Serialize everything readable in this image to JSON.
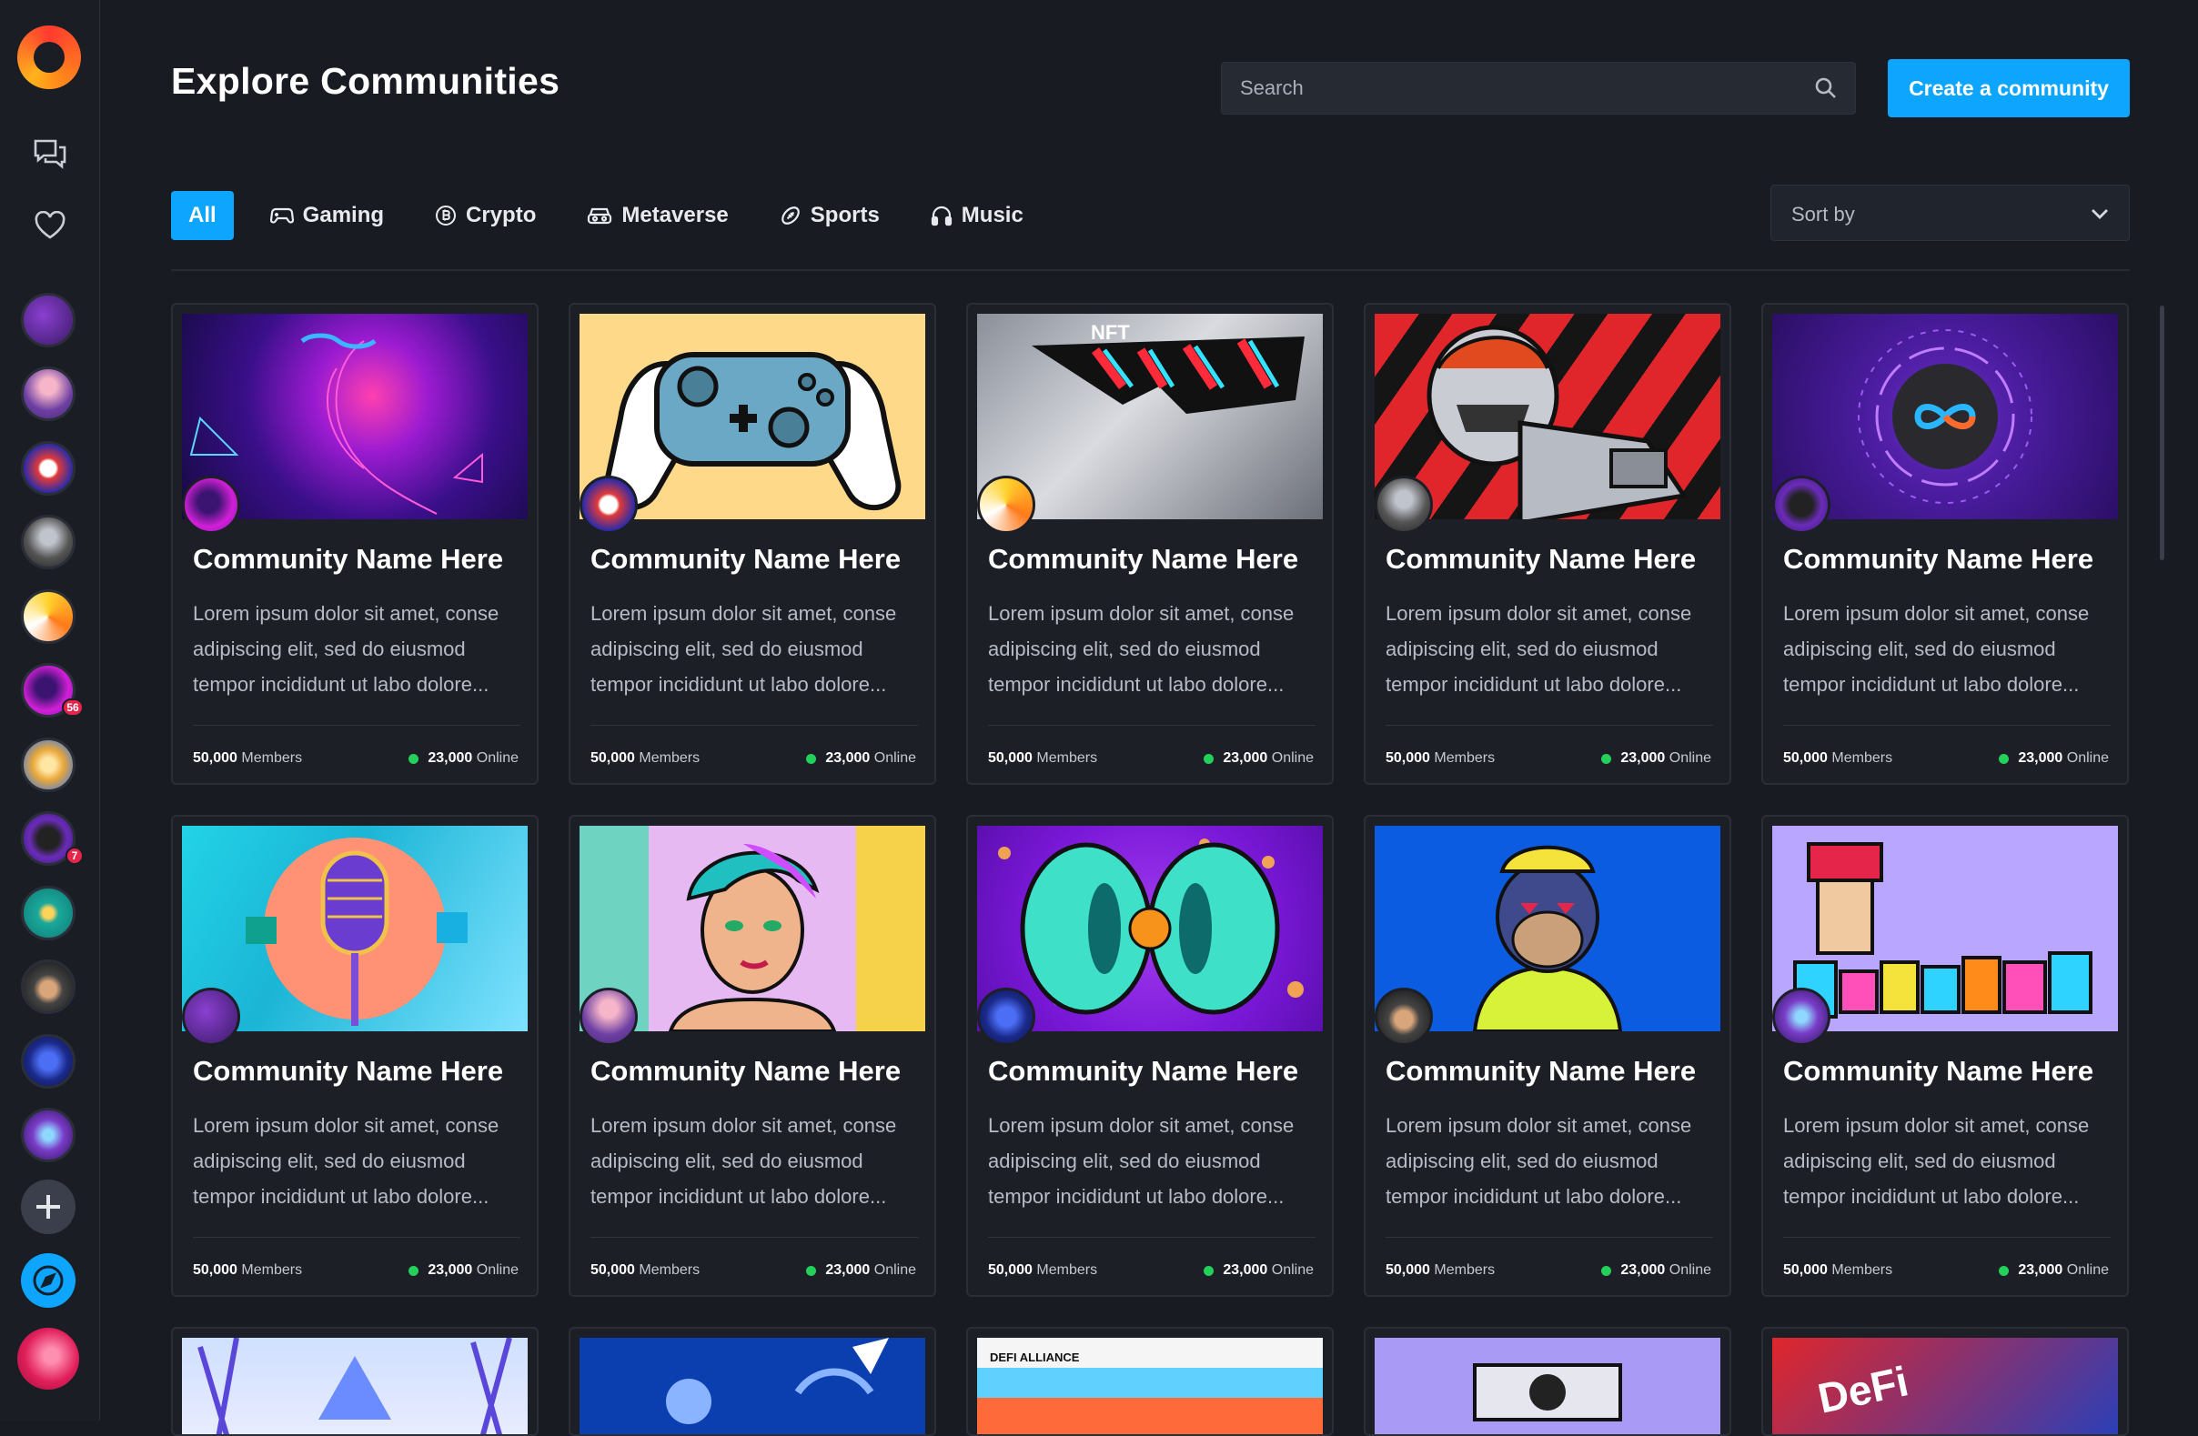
{
  "app": {
    "page_title": "Explore Communities"
  },
  "search": {
    "placeholder": "Search"
  },
  "actions": {
    "create_label": "Create a community"
  },
  "tabs": [
    {
      "label": "All",
      "icon": "none"
    },
    {
      "label": "Gaming",
      "icon": "gamepad-icon"
    },
    {
      "label": "Crypto",
      "icon": "bitcoin-icon"
    },
    {
      "label": "Metaverse",
      "icon": "vr-headset-icon"
    },
    {
      "label": "Sports",
      "icon": "football-icon"
    },
    {
      "label": "Music",
      "icon": "headphones-icon"
    }
  ],
  "sort": {
    "label": "Sort by"
  },
  "sidebar": {
    "badges": [
      "56",
      "7"
    ]
  },
  "cards": [
    {
      "name": "Community Name Here",
      "desc": "Lorem ipsum dolor sit amet, conse adipiscing elit, sed do eiusmod tempor incididunt ut labo dolore...",
      "members_count": "50,000",
      "members_label": "Members",
      "online_count": "23,000",
      "online_label": "Online"
    },
    {
      "name": "Community Name Here",
      "desc": "Lorem ipsum dolor sit amet, conse adipiscing elit, sed do eiusmod tempor incididunt ut labo dolore...",
      "members_count": "50,000",
      "members_label": "Members",
      "online_count": "23,000",
      "online_label": "Online"
    },
    {
      "name": "Community Name Here",
      "desc": "Lorem ipsum dolor sit amet, conse adipiscing elit, sed do eiusmod tempor incididunt ut labo dolore...",
      "members_count": "50,000",
      "members_label": "Members",
      "online_count": "23,000",
      "online_label": "Online"
    },
    {
      "name": "Community Name Here",
      "desc": "Lorem ipsum dolor sit amet, conse adipiscing elit, sed do eiusmod tempor incididunt ut labo dolore...",
      "members_count": "50,000",
      "members_label": "Members",
      "online_count": "23,000",
      "online_label": "Online"
    },
    {
      "name": "Community Name Here",
      "desc": "Lorem ipsum dolor sit amet, conse adipiscing elit, sed do eiusmod tempor incididunt ut labo dolore...",
      "members_count": "50,000",
      "members_label": "Members",
      "online_count": "23,000",
      "online_label": "Online"
    },
    {
      "name": "Community Name Here",
      "desc": "Lorem ipsum dolor sit amet, conse adipiscing elit, sed do eiusmod tempor incididunt ut labo dolore...",
      "members_count": "50,000",
      "members_label": "Members",
      "online_count": "23,000",
      "online_label": "Online"
    },
    {
      "name": "Community Name Here",
      "desc": "Lorem ipsum dolor sit amet, conse adipiscing elit, sed do eiusmod tempor incididunt ut labo dolore...",
      "members_count": "50,000",
      "members_label": "Members",
      "online_count": "23,000",
      "online_label": "Online"
    },
    {
      "name": "Community Name Here",
      "desc": "Lorem ipsum dolor sit amet, conse adipiscing elit, sed do eiusmod tempor incididunt ut labo dolore...",
      "members_count": "50,000",
      "members_label": "Members",
      "online_count": "23,000",
      "online_label": "Online"
    },
    {
      "name": "Community Name Here",
      "desc": "Lorem ipsum dolor sit amet, conse adipiscing elit, sed do eiusmod tempor incididunt ut labo dolore...",
      "members_count": "50,000",
      "members_label": "Members",
      "online_count": "23,000",
      "online_label": "Online"
    },
    {
      "name": "Community Name Here",
      "desc": "Lorem ipsum dolor sit amet, conse adipiscing elit, sed do eiusmod tempor incididunt ut labo dolore...",
      "members_count": "50,000",
      "members_label": "Members",
      "online_count": "23,000",
      "online_label": "Online"
    }
  ],
  "bottom_row_labels": [
    "NFT",
    "DEFI ALLIANCE",
    "DeFi"
  ],
  "colors": {
    "accent": "#0ea5ff",
    "online": "#22d05a",
    "background": "#181b22",
    "card": "#1c1f26"
  }
}
